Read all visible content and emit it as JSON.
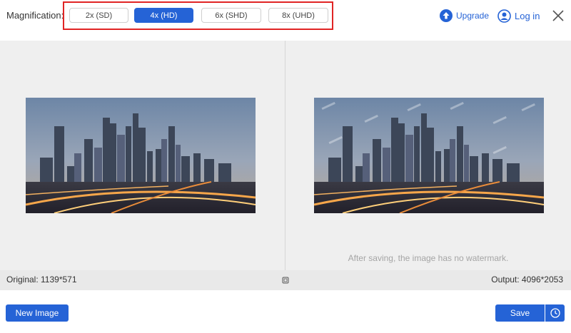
{
  "magnification": {
    "label": "Magnification:",
    "options": [
      "2x (SD)",
      "4x (HD)",
      "6x (SHD)",
      "8x (UHD)"
    ],
    "selected": "4x (HD)"
  },
  "header": {
    "upgrade_label": "Upgrade",
    "login_label": "Log in",
    "upgrade_icon": "upload-arrow-icon",
    "login_icon": "user-icon",
    "close_icon": "close-icon"
  },
  "preview": {
    "watermark_note": "After saving, the image has no watermark."
  },
  "status": {
    "original": "Original: 1139*571",
    "output": "Output: 4096*2053"
  },
  "footer": {
    "new_image_label": "New Image",
    "save_label": "Save",
    "history_icon": "clock-icon"
  },
  "colors": {
    "accent": "#2563d6",
    "highlight_border": "#e02424",
    "panel_bg": "#efefef"
  }
}
